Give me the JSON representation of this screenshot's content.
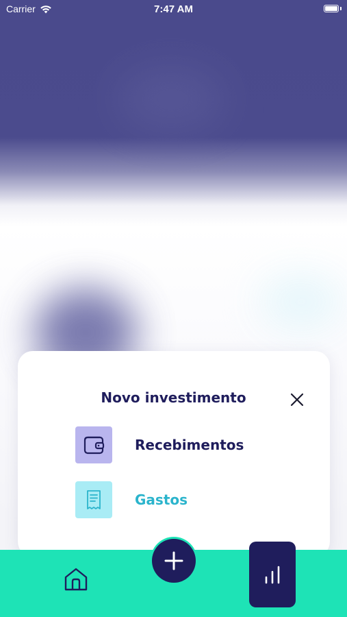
{
  "status_bar": {
    "carrier": "Carrier",
    "time": "7:47 AM",
    "icons": [
      "wifi-icon",
      "battery-icon"
    ]
  },
  "modal": {
    "title": "Novo investimento",
    "close_icon": "close-icon",
    "options": [
      {
        "label": "Recebimentos",
        "icon": "wallet-icon",
        "icon_bg": "#b9b5ee",
        "text_color": "#1f1d5c"
      },
      {
        "label": "Gastos",
        "icon": "receipt-icon",
        "icon_bg": "#a9ecf5",
        "text_color": "#2bb4cc"
      }
    ]
  },
  "tab_bar": {
    "background": "#1ee3b6",
    "items": [
      {
        "icon": "home-icon"
      },
      {
        "icon": "plus-icon"
      },
      {
        "icon": "bar-chart-icon",
        "active": true
      }
    ]
  },
  "colors": {
    "primary_dark": "#1f1d5c",
    "accent_teal": "#1ee3b6",
    "header_purple": "#4a4a8c"
  }
}
